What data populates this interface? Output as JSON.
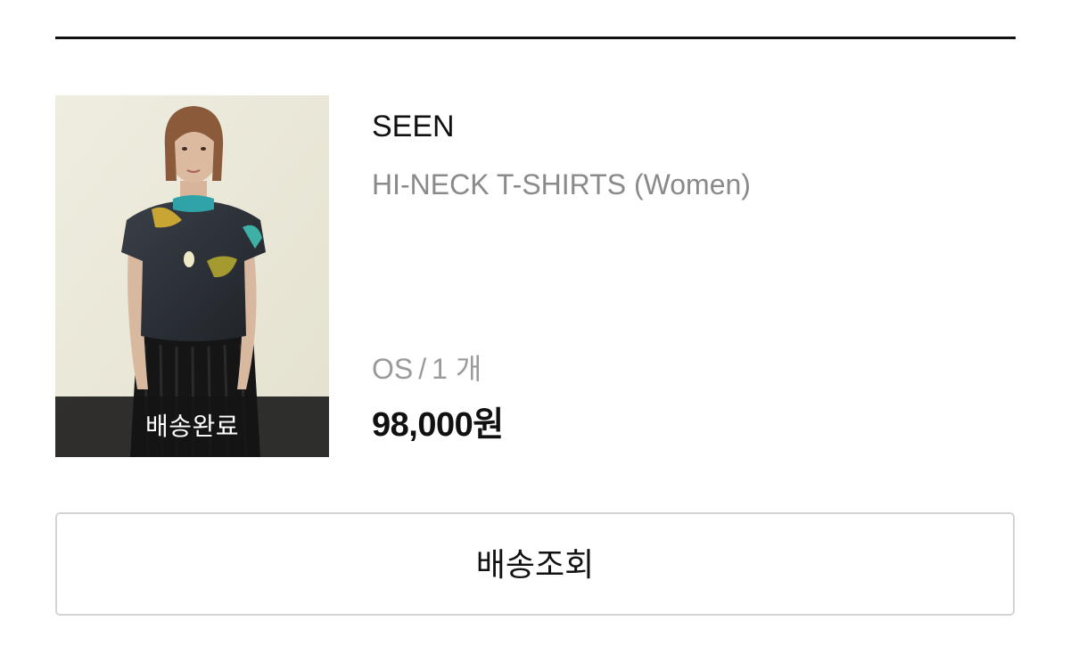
{
  "order_item": {
    "status": "배송완료",
    "brand": "SEEN",
    "product_name": "HI-NECK T-SHIRTS (Women)",
    "option": {
      "size": "OS",
      "separator": "/",
      "quantity": "1 개"
    },
    "price": "98,000원",
    "thumbnail": {
      "icon": "product-photo",
      "description_colors": {
        "background": "#ebe8d9",
        "garment": "#2b3036",
        "skirt": "#141414",
        "hair": "#8a5a3a"
      }
    }
  },
  "actions": {
    "track_shipping_label": "배송조회"
  }
}
